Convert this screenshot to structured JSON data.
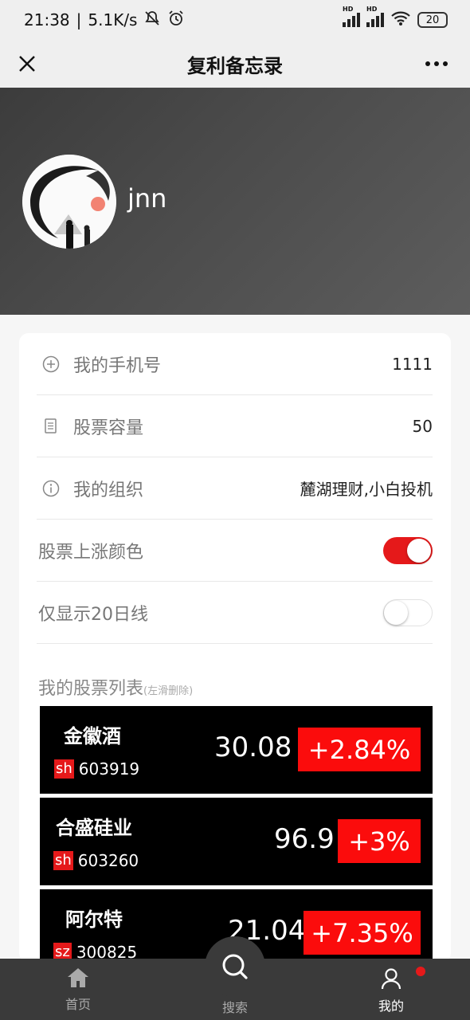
{
  "status_bar": {
    "time": "21:38",
    "speed": "5.1K/s",
    "battery": "20",
    "hd1": "HD",
    "hd2": "HD"
  },
  "title_bar": {
    "title": "复利备忘录"
  },
  "profile": {
    "username": "jnn"
  },
  "settings": {
    "phone_label": "我的手机号",
    "phone_value": "1111",
    "capacity_label": "股票容量",
    "capacity_value": "50",
    "org_label": "我的组织",
    "org_value": "麓湖理财,小白投机",
    "rise_color_label": "股票上涨颜色",
    "rise_color_on": true,
    "ma20_label": "仅显示20日线",
    "ma20_on": false
  },
  "stock_list": {
    "title": "我的股票列表",
    "hint": "(左滑删除)",
    "items": [
      {
        "name": "金徽酒",
        "market": "sh",
        "code": "603919",
        "price": "30.08",
        "change": "+2.84%"
      },
      {
        "name": "合盛硅业",
        "market": "sh",
        "code": "603260",
        "price": "96.9",
        "change": "+3%"
      },
      {
        "name": "阿尔特",
        "market": "sz",
        "code": "300825",
        "price": "21.04",
        "change": "+7.35%"
      }
    ]
  },
  "bottom_nav": {
    "home": "首页",
    "search": "搜索",
    "mine": "我的"
  },
  "colors": {
    "accent_red": "#e5191a",
    "change_red": "#fb0c0c",
    "header_gray": "#4a4a4a"
  }
}
